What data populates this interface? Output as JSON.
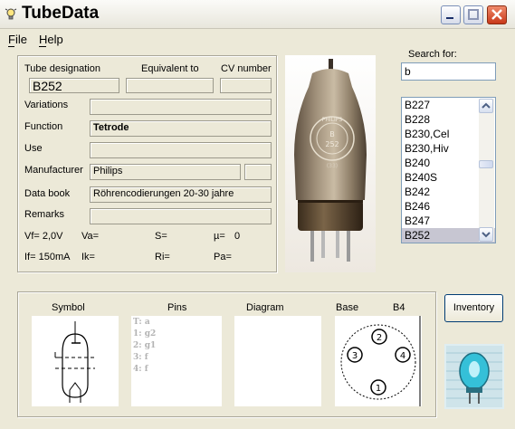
{
  "window": {
    "title": "TubeData"
  },
  "menu": {
    "file": "File",
    "help": "Help"
  },
  "details": {
    "col_tube_designation": "Tube designation",
    "col_equivalent": "Equivalent to",
    "col_cv": "CV number",
    "tube_designation": "B252",
    "equivalent": "",
    "cv_number": "",
    "variations_label": "Variations",
    "variations": "",
    "function_label": "Function",
    "function": "Tetrode",
    "use_label": "Use",
    "use": "",
    "manufacturer_label": "Manufacturer",
    "manufacturer": "Philips",
    "manufacturer_extra": "",
    "databook_label": "Data book",
    "databook": "Röhrencodierungen 20-30 jahre",
    "remarks_label": "Remarks",
    "remarks": "",
    "vf": "Vf= 2,0V",
    "va": "Va=",
    "s": "S=",
    "mu_label": "µ=",
    "mu_value": "0",
    "if": "If= 150mA",
    "ik": "Ik=",
    "ri": "Ri=",
    "pa": "Pa="
  },
  "search": {
    "label": "Search for:",
    "value": "b",
    "results": [
      "B227",
      "B228",
      "B230,Cel",
      "B230,Hiv",
      "B240",
      "B240S",
      "B242",
      "B246",
      "B247",
      "B252"
    ],
    "selected_index": 9
  },
  "bottom": {
    "symbol_label": "Symbol",
    "pins_label": "Pins",
    "diagram_label": "Diagram",
    "base_label": "Base",
    "base_value": "B4",
    "pins": [
      "T: a",
      "1: g2",
      "2: g1",
      "3: f",
      "4: f"
    ],
    "base_pins": [
      "1",
      "2",
      "3",
      "4"
    ]
  },
  "inventory_button": "Inventory",
  "photo_logo": {
    "brand": "PHILIPS",
    "code1": "B",
    "code2": "252",
    "code3": "(33)"
  }
}
